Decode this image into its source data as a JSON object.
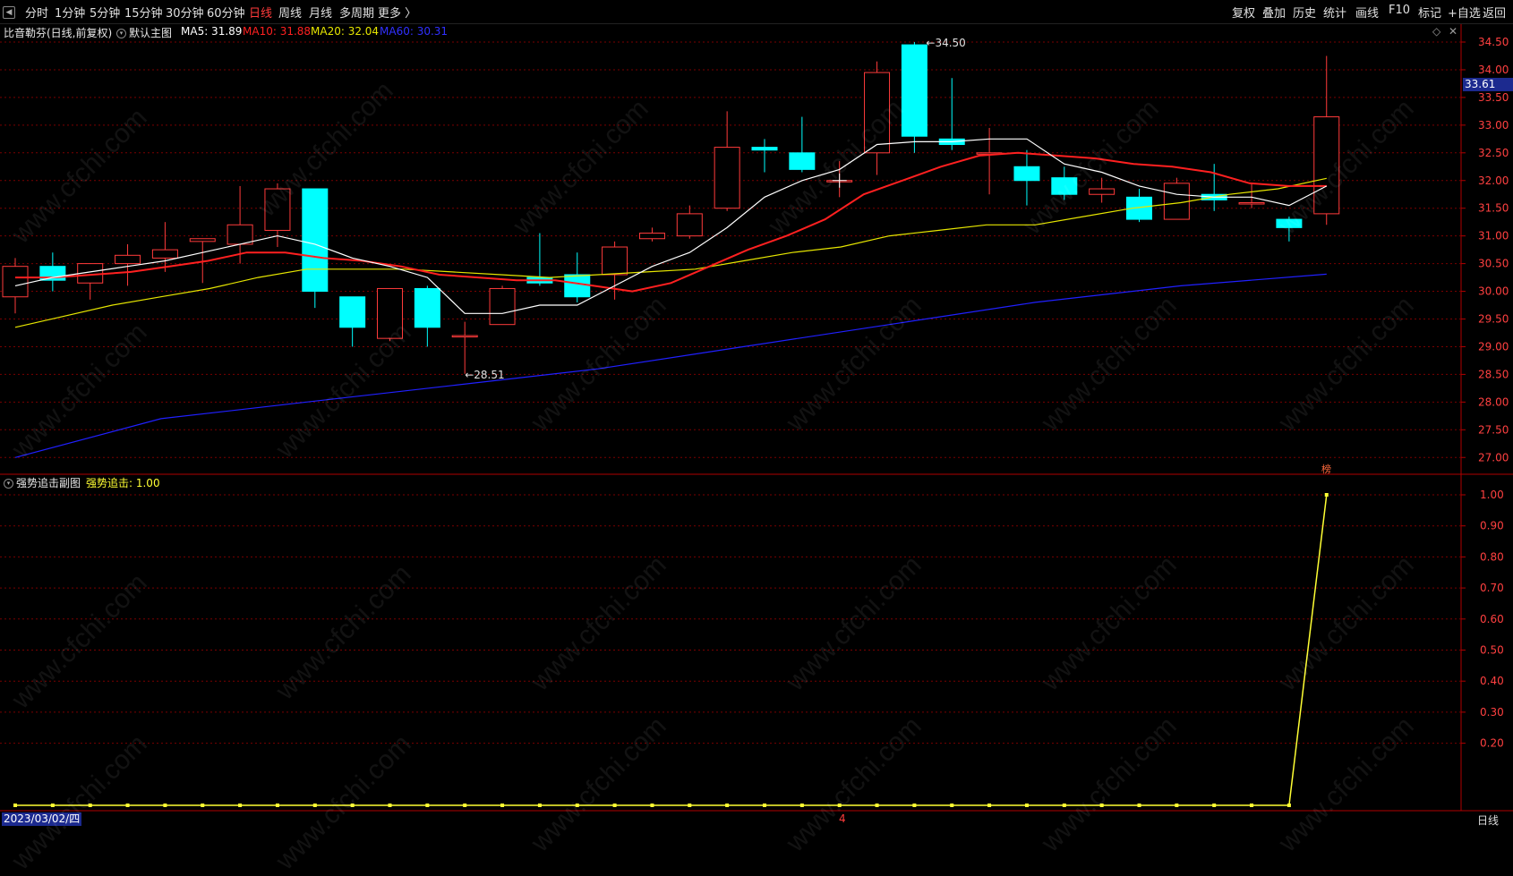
{
  "toolbar": {
    "nav_icon": "chevron-left-icon",
    "periods": [
      "分时",
      "1分钟",
      "5分钟",
      "15分钟",
      "30分钟",
      "60分钟",
      "日线",
      "周线",
      "月线",
      "多周期",
      "更多 〉"
    ],
    "active_period": "日线",
    "right_buttons": [
      "复权",
      "叠加",
      "历史",
      "统计",
      "画线",
      "F10",
      "标记",
      "+自选",
      "返回"
    ]
  },
  "main_panel": {
    "title": "比音勒芬(日线,前复权)",
    "chart_name": "默认主图",
    "ma5": "MA5: 31.89",
    "ma10": "MA10: 31.88",
    "ma20": "MA20: 32.04",
    "ma60": "MA60: 30.31",
    "high_label": "←34.50",
    "low_label": "←28.51",
    "current_price": "33.61",
    "corner_mark": "榜",
    "diamond_icon": "diamond-icon",
    "close_icon": "close-icon"
  },
  "sub_panel": {
    "title": "强势追击副图",
    "value_label": "强势追击: 1.00"
  },
  "bottom": {
    "date": "2023/03/02/四",
    "mid_label": "4",
    "period": "日线"
  },
  "watermark": "www.cfchi.com",
  "colors": {
    "up": "#ff3b3b",
    "down": "#00ffff",
    "ma5": "#ffffff",
    "ma10": "#ff2020",
    "ma20": "#e6e600",
    "ma60": "#2020ff",
    "indicator": "#ffff33",
    "grid": "#7a0000"
  },
  "chart_data": [
    {
      "type": "candlestick",
      "title": "比音勒芬(日线,前复权)",
      "ylim": [
        26.75,
        34.75
      ],
      "yticks": [
        "34.50",
        "34.00",
        "33.50",
        "33.00",
        "32.50",
        "32.00",
        "31.50",
        "31.00",
        "30.50",
        "30.00",
        "29.50",
        "29.00",
        "28.50",
        "28.00",
        "27.50",
        "27.00"
      ],
      "candles": [
        {
          "open": 29.9,
          "close": 30.45,
          "high": 30.6,
          "low": 29.6
        },
        {
          "open": 30.45,
          "close": 30.2,
          "high": 30.7,
          "low": 30.0
        },
        {
          "open": 30.15,
          "close": 30.5,
          "high": 30.5,
          "low": 29.85
        },
        {
          "open": 30.5,
          "close": 30.65,
          "high": 30.85,
          "low": 30.1
        },
        {
          "open": 30.6,
          "close": 30.75,
          "high": 31.25,
          "low": 30.35
        },
        {
          "open": 30.9,
          "close": 30.95,
          "high": 30.9,
          "low": 30.15
        },
        {
          "open": 30.85,
          "close": 31.2,
          "high": 31.9,
          "low": 30.5
        },
        {
          "open": 31.1,
          "close": 31.85,
          "high": 31.95,
          "low": 30.8
        },
        {
          "open": 31.85,
          "close": 30.0,
          "high": 31.85,
          "low": 29.7
        },
        {
          "open": 29.9,
          "close": 29.35,
          "high": 29.9,
          "low": 29.0
        },
        {
          "open": 29.15,
          "close": 30.05,
          "high": 30.05,
          "low": 29.1
        },
        {
          "open": 30.05,
          "close": 29.35,
          "high": 30.1,
          "low": 29.0
        },
        {
          "open": 29.2,
          "close": 29.2,
          "high": 29.45,
          "low": 28.51
        },
        {
          "open": 29.4,
          "close": 30.05,
          "high": 30.1,
          "low": 29.4
        },
        {
          "open": 30.25,
          "close": 30.15,
          "high": 31.05,
          "low": 30.1
        },
        {
          "open": 30.3,
          "close": 29.9,
          "high": 30.7,
          "low": 29.8
        },
        {
          "open": 30.3,
          "close": 30.8,
          "high": 30.9,
          "low": 29.85
        },
        {
          "open": 30.95,
          "close": 31.05,
          "high": 31.15,
          "low": 30.9
        },
        {
          "open": 31.0,
          "close": 31.4,
          "high": 31.55,
          "low": 30.95
        },
        {
          "open": 31.5,
          "close": 32.6,
          "high": 33.25,
          "low": 31.45
        },
        {
          "open": 32.6,
          "close": 32.55,
          "high": 32.75,
          "low": 32.15
        },
        {
          "open": 32.5,
          "close": 32.2,
          "high": 33.15,
          "low": 32.15
        },
        {
          "open": 32.0,
          "close": 32.0,
          "high": 32.35,
          "low": 31.7
        },
        {
          "open": 32.5,
          "close": 33.95,
          "high": 34.15,
          "low": 32.1
        },
        {
          "open": 34.45,
          "close": 32.8,
          "high": 34.5,
          "low": 32.5
        },
        {
          "open": 32.75,
          "close": 32.65,
          "high": 33.85,
          "low": 32.55
        },
        {
          "open": 32.5,
          "close": 32.5,
          "high": 32.95,
          "low": 31.75
        },
        {
          "open": 32.25,
          "close": 32.0,
          "high": 32.55,
          "low": 31.55
        },
        {
          "open": 32.05,
          "close": 31.75,
          "high": 32.25,
          "low": 31.65
        },
        {
          "open": 31.75,
          "close": 31.85,
          "high": 32.05,
          "low": 31.6
        },
        {
          "open": 31.7,
          "close": 31.3,
          "high": 31.85,
          "low": 31.25
        },
        {
          "open": 31.3,
          "close": 31.95,
          "high": 32.05,
          "low": 31.3
        },
        {
          "open": 31.75,
          "close": 31.65,
          "high": 32.3,
          "low": 31.45
        },
        {
          "open": 31.6,
          "close": 31.6,
          "high": 31.95,
          "low": 31.5
        },
        {
          "open": 31.3,
          "close": 31.15,
          "high": 31.35,
          "low": 30.9
        },
        {
          "open": 31.4,
          "close": 33.15,
          "high": 34.25,
          "low": 31.2
        }
      ],
      "ma5": [
        30.1,
        30.25,
        30.35,
        30.45,
        30.55,
        30.7,
        30.85,
        31.0,
        30.85,
        30.6,
        30.45,
        30.25,
        29.6,
        29.6,
        29.75,
        29.75,
        30.1,
        30.45,
        30.7,
        31.15,
        31.7,
        32.0,
        32.2,
        32.65,
        32.7,
        32.7,
        32.75,
        32.75,
        32.3,
        32.15,
        31.9,
        31.75,
        31.7,
        31.7,
        31.55,
        31.9
      ],
      "ma10": [
        30.25,
        30.25,
        30.3,
        30.35,
        30.45,
        30.55,
        30.7,
        30.7,
        30.6,
        30.55,
        30.45,
        30.3,
        30.25,
        30.2,
        30.2,
        30.1,
        30.0,
        30.15,
        30.45,
        30.75,
        31.0,
        31.3,
        31.75,
        32.0,
        32.25,
        32.45,
        32.5,
        32.45,
        32.4,
        32.3,
        32.25,
        32.15,
        31.95,
        31.9,
        31.9
      ],
      "ma20": [
        29.35,
        29.55,
        29.75,
        29.9,
        30.05,
        30.25,
        30.4,
        30.4,
        30.4,
        30.35,
        30.3,
        30.25,
        30.3,
        30.35,
        30.4,
        30.55,
        30.7,
        30.8,
        31.0,
        31.1,
        31.2,
        31.2,
        31.35,
        31.5,
        31.6,
        31.75,
        31.85,
        32.04
      ],
      "ma60": [
        27.0,
        27.7,
        28.0,
        28.3,
        28.6,
        29.0,
        29.4,
        29.8,
        30.1,
        30.31
      ],
      "high_point": {
        "value": 34.5,
        "label": "←34.50"
      },
      "low_point": {
        "value": 28.51,
        "label": "←28.51"
      }
    },
    {
      "type": "line",
      "title": "强势追击副图",
      "series": [
        {
          "name": "强势追击",
          "values": [
            0,
            0,
            0,
            0,
            0,
            0,
            0,
            0,
            0,
            0,
            0,
            0,
            0,
            0,
            0,
            0,
            0,
            0,
            0,
            0,
            0,
            0,
            0,
            0,
            0,
            0,
            0,
            0,
            0,
            0,
            0,
            0,
            0,
            0,
            0,
            1.0
          ]
        }
      ],
      "ylim": [
        0,
        1.05
      ],
      "yticks": [
        "1.00",
        "0.90",
        "0.80",
        "0.70",
        "0.60",
        "0.50",
        "0.40",
        "0.30",
        "0.20"
      ]
    }
  ]
}
